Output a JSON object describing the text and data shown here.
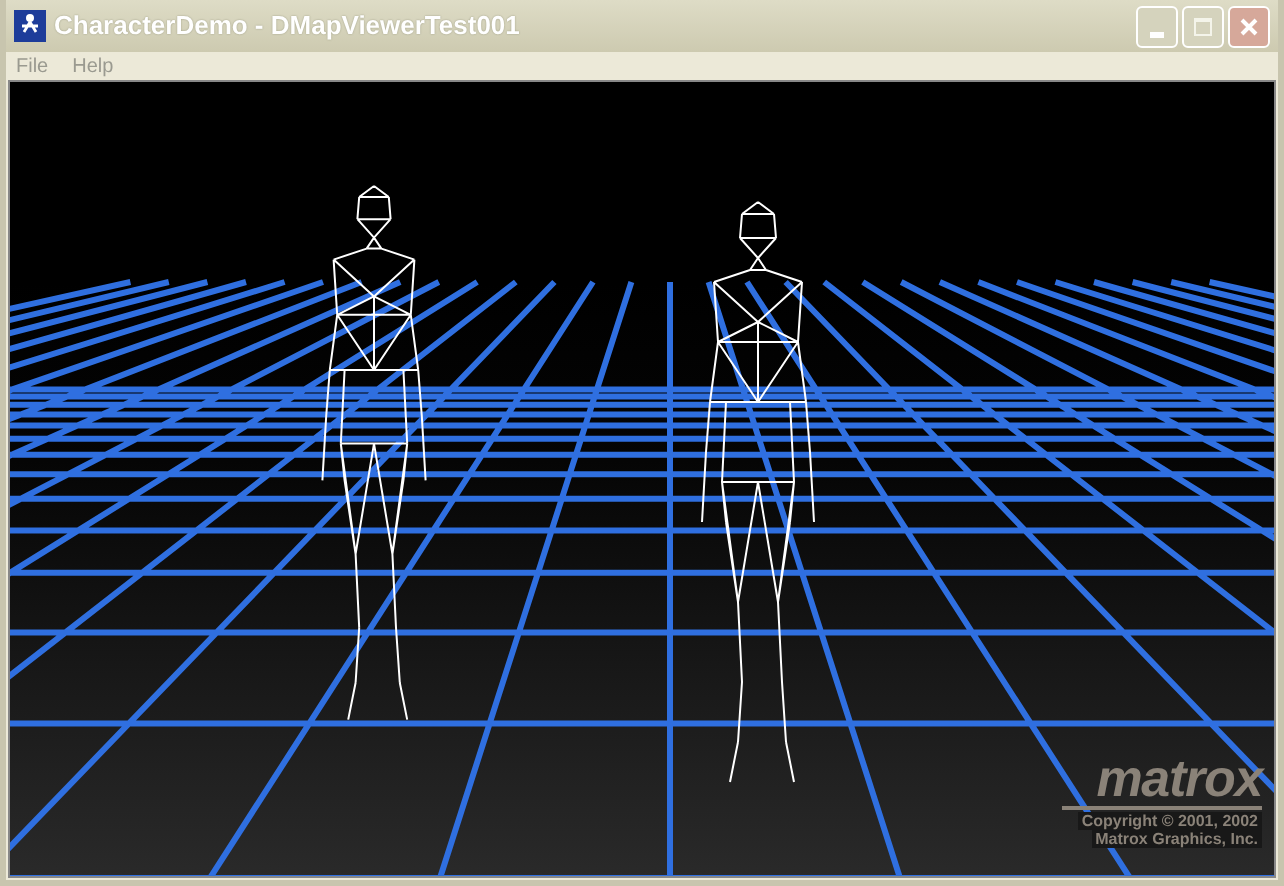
{
  "window": {
    "title": "CharacterDemo - DMapViewerTest001"
  },
  "menu": [
    {
      "label": "File"
    },
    {
      "label": "Help"
    }
  ],
  "logo": {
    "wordmark": "matrox",
    "lines": [
      "Copyright © 2001, 2002",
      "Matrox Graphics, Inc."
    ]
  }
}
